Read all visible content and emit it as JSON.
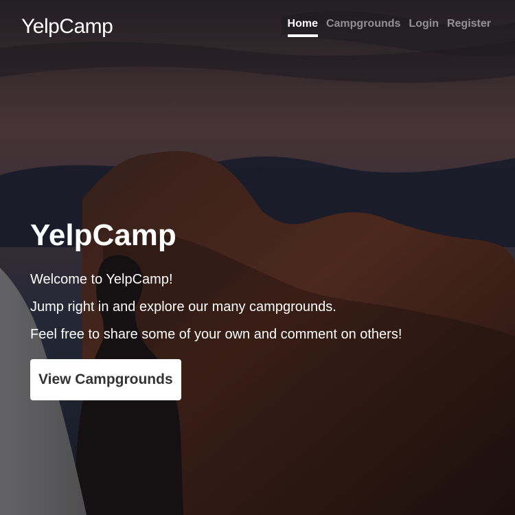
{
  "header": {
    "brand": "YelpCamp",
    "nav": [
      {
        "label": "Home",
        "active": true
      },
      {
        "label": "Campgrounds",
        "active": false
      },
      {
        "label": "Login",
        "active": false
      },
      {
        "label": "Register",
        "active": false
      }
    ]
  },
  "hero": {
    "title": "YelpCamp",
    "lines": [
      "Welcome to YelpCamp!",
      "Jump right in and explore our many campgrounds.",
      "Feel free to share some of your own and comment on others!"
    ],
    "button_label": "View Campgrounds"
  },
  "colors": {
    "text": "#ffffff",
    "button_bg": "#ffffff",
    "button_text": "#333333"
  }
}
